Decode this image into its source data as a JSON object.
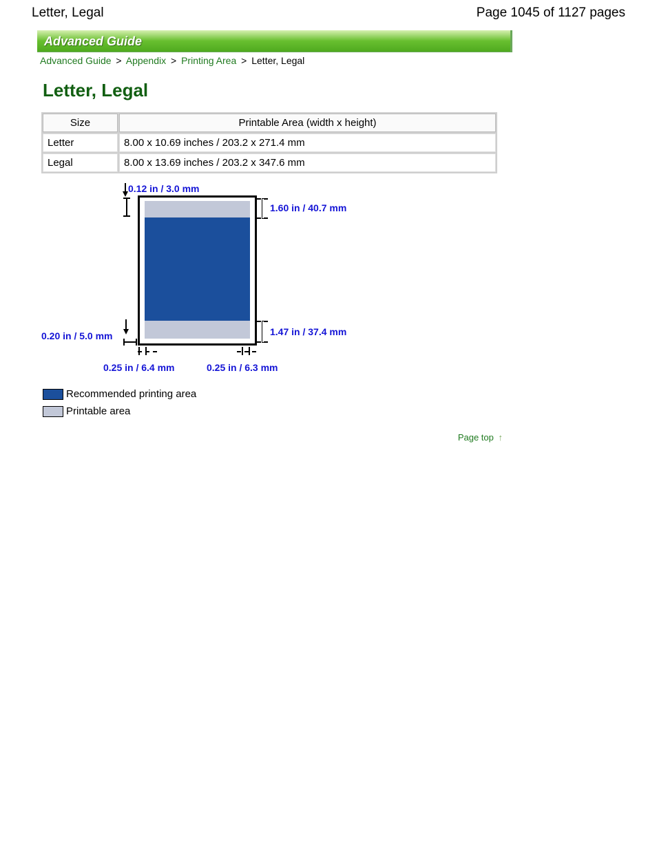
{
  "header": {
    "title": "Letter, Legal",
    "page_indicator": "Page 1045 of 1127 pages"
  },
  "banner": "Advanced Guide",
  "breadcrumb": {
    "items": [
      "Advanced Guide",
      "Appendix",
      "Printing Area"
    ],
    "current": "Letter, Legal",
    "sep": ">"
  },
  "heading": "Letter, Legal",
  "table": {
    "col_size": "Size",
    "col_area": "Printable Area (width x height)",
    "rows": [
      {
        "size": "Letter",
        "area": "8.00 x 10.69 inches / 203.2 x 271.4 mm"
      },
      {
        "size": "Legal",
        "area": "8.00 x 13.69 inches / 203.2 x 347.6 mm"
      }
    ]
  },
  "diagram": {
    "top_margin": "0.12 in / 3.0 mm",
    "top_region": "1.60 in / 40.7 mm",
    "bottom_region": "1.47 in / 37.4 mm",
    "left_margin": "0.20 in / 5.0 mm",
    "bottom_left": "0.25 in / 6.4 mm",
    "bottom_right": "0.25 in / 6.3 mm"
  },
  "legend": {
    "recommended": "Recommended printing area",
    "printable": "Printable area"
  },
  "pagetop": "Page top"
}
